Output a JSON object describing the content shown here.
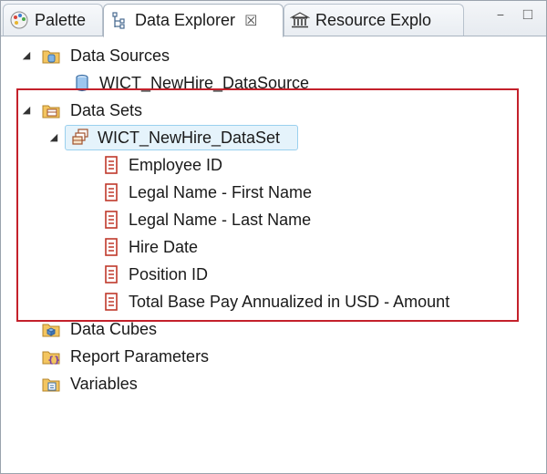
{
  "tabs": [
    {
      "label": "Palette",
      "icon": "palette-icon",
      "active": false
    },
    {
      "label": "Data Explorer",
      "icon": "data-explorer-icon",
      "active": true,
      "close": "☒"
    },
    {
      "label": "Resource Explo",
      "icon": "resource-explorer-icon",
      "active": false
    }
  ],
  "window_controls": {
    "minimize": "−",
    "maximize": "□"
  },
  "tree": {
    "data_sources": {
      "label": "Data Sources",
      "expander": "◢",
      "children": [
        {
          "label": "WICT_NewHire_DataSource",
          "icon": "database-icon"
        }
      ]
    },
    "data_sets": {
      "label": "Data Sets",
      "expander": "◢",
      "dataset": {
        "label": "WICT_NewHire_DataSet",
        "expander": "◢",
        "fields": [
          {
            "label": "Employee ID"
          },
          {
            "label": "Legal Name - First Name"
          },
          {
            "label": "Legal Name - Last Name"
          },
          {
            "label": "Hire Date"
          },
          {
            "label": "Position ID"
          },
          {
            "label": "Total Base Pay Annualized in USD - Amount"
          }
        ]
      }
    },
    "data_cubes": {
      "label": "Data Cubes"
    },
    "report_parameters": {
      "label": "Report Parameters"
    },
    "variables": {
      "label": "Variables"
    }
  },
  "colors": {
    "highlight_border": "#c4212b",
    "selection_fill": "#e5f3fb",
    "selection_border": "#9ad0ee",
    "folder": "#e8b84a",
    "field_icon": "#c0392b"
  }
}
